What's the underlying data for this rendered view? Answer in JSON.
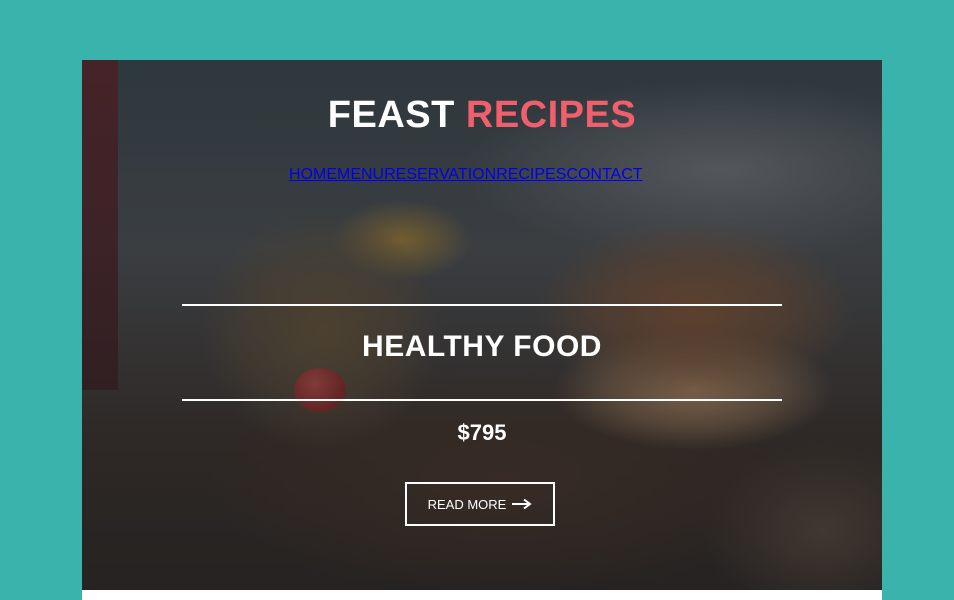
{
  "brand": {
    "word1": "FEAST",
    "word2": "RECIPES"
  },
  "nav": {
    "items": [
      {
        "label": "HOME",
        "active": true
      },
      {
        "label": "MENU"
      },
      {
        "label": "RESERVATION"
      },
      {
        "label": "RECIPES"
      },
      {
        "label": "CONTACT"
      }
    ]
  },
  "hero": {
    "title": "HEALTHY FOOD",
    "price": "$795",
    "button_label": "READ MORE",
    "button_icon": "arrow-right-icon"
  },
  "colors": {
    "page_bg": "#3bb3ad",
    "accent": "#f0606c",
    "active_nav": "#f28a72"
  }
}
